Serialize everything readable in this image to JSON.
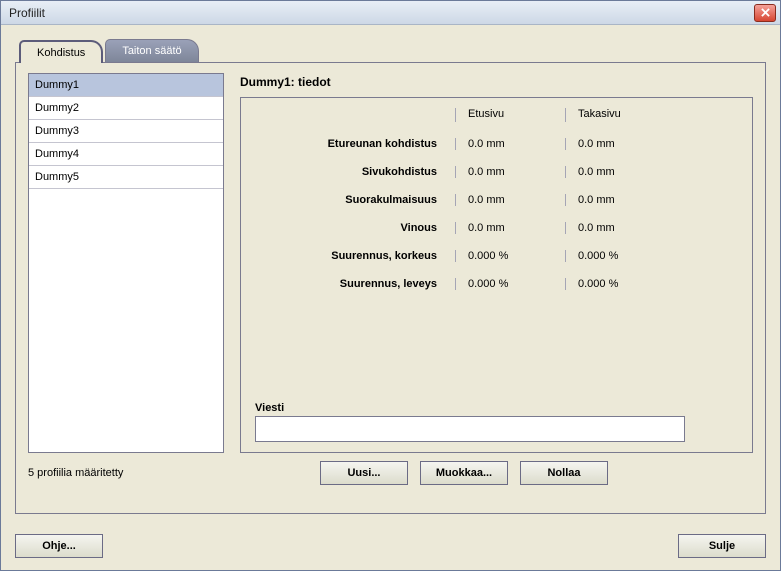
{
  "window": {
    "title": "Profiilit"
  },
  "tabs": [
    {
      "label": "Kohdistus",
      "active": true
    },
    {
      "label": "Taiton säätö",
      "active": false
    }
  ],
  "profiles": {
    "items": [
      {
        "name": "Dummy1",
        "selected": true
      },
      {
        "name": "Dummy2",
        "selected": false
      },
      {
        "name": "Dummy3",
        "selected": false
      },
      {
        "name": "Dummy4",
        "selected": false
      },
      {
        "name": "Dummy5",
        "selected": false
      }
    ],
    "count_label": "5 profiilia määritetty"
  },
  "details": {
    "title": "Dummy1: tiedot",
    "columns": {
      "front": "Etusivu",
      "back": "Takasivu"
    },
    "rows": [
      {
        "label": "Etureunan kohdistus",
        "front": "0.0 mm",
        "back": "0.0 mm"
      },
      {
        "label": "Sivukohdistus",
        "front": "0.0 mm",
        "back": "0.0 mm"
      },
      {
        "label": "Suorakulmaisuus",
        "front": "0.0 mm",
        "back": "0.0 mm"
      },
      {
        "label": "Vinous",
        "front": "0.0 mm",
        "back": "0.0 mm"
      },
      {
        "label": "Suurennus, korkeus",
        "front": "0.000 %",
        "back": "0.000 %"
      },
      {
        "label": "Suurennus, leveys",
        "front": "0.000 %",
        "back": "0.000 %"
      }
    ],
    "message_label": "Viesti",
    "message_value": ""
  },
  "buttons": {
    "new": "Uusi...",
    "edit": "Muokkaa...",
    "reset": "Nollaa",
    "help": "Ohje...",
    "close": "Sulje"
  }
}
